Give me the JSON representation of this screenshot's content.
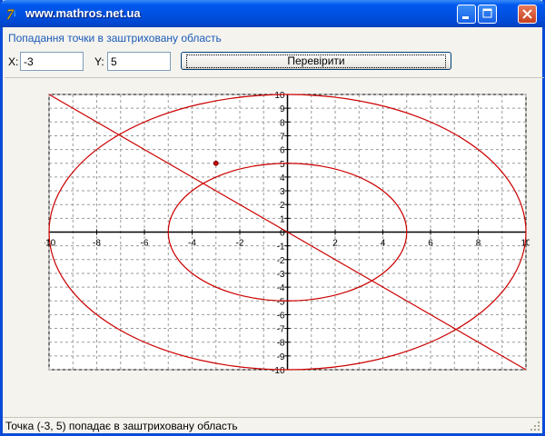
{
  "window": {
    "title": "www.mathros.net.ua"
  },
  "form": {
    "caption": "Попадання точки в заштриховану область",
    "x_label": "X:",
    "y_label": "Y:",
    "x_value": "-3",
    "y_value": "5",
    "check_button": "Перевірити"
  },
  "chart_data": {
    "type": "scatter",
    "xlim": [
      -10,
      10
    ],
    "ylim": [
      -10,
      10
    ],
    "x_ticks": [
      -10,
      -8,
      -6,
      -4,
      -2,
      0,
      2,
      4,
      6,
      8,
      10
    ],
    "y_ticks": [
      -10,
      -9,
      -8,
      -7,
      -6,
      -5,
      -4,
      -3,
      -2,
      -1,
      0,
      1,
      2,
      3,
      4,
      5,
      6,
      7,
      8,
      9,
      10
    ],
    "grid": true,
    "curves": [
      {
        "kind": "ellipse",
        "cx": 0,
        "cy": 0,
        "rx": 10,
        "ry": 10,
        "color": "#CC0000"
      },
      {
        "kind": "ellipse",
        "cx": 0,
        "cy": 0,
        "rx": 5,
        "ry": 5,
        "color": "#CC0000"
      },
      {
        "kind": "line",
        "points": [
          [
            -10,
            10
          ],
          [
            10,
            -10
          ]
        ],
        "color": "#CC0000"
      }
    ],
    "points": [
      {
        "x": -3,
        "y": 5,
        "color": "#CC0000"
      }
    ]
  },
  "status": {
    "text": "Точка (-3, 5) попадає в заштриховану область"
  }
}
